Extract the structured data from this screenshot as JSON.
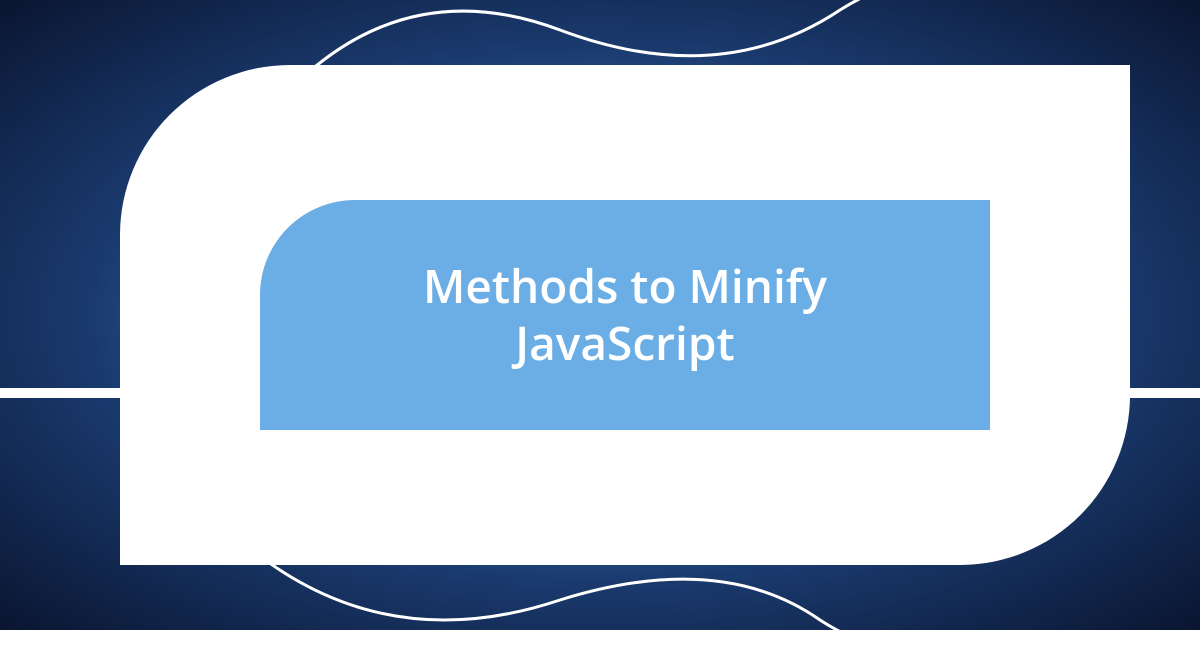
{
  "title": "Methods to Minify JavaScript"
}
